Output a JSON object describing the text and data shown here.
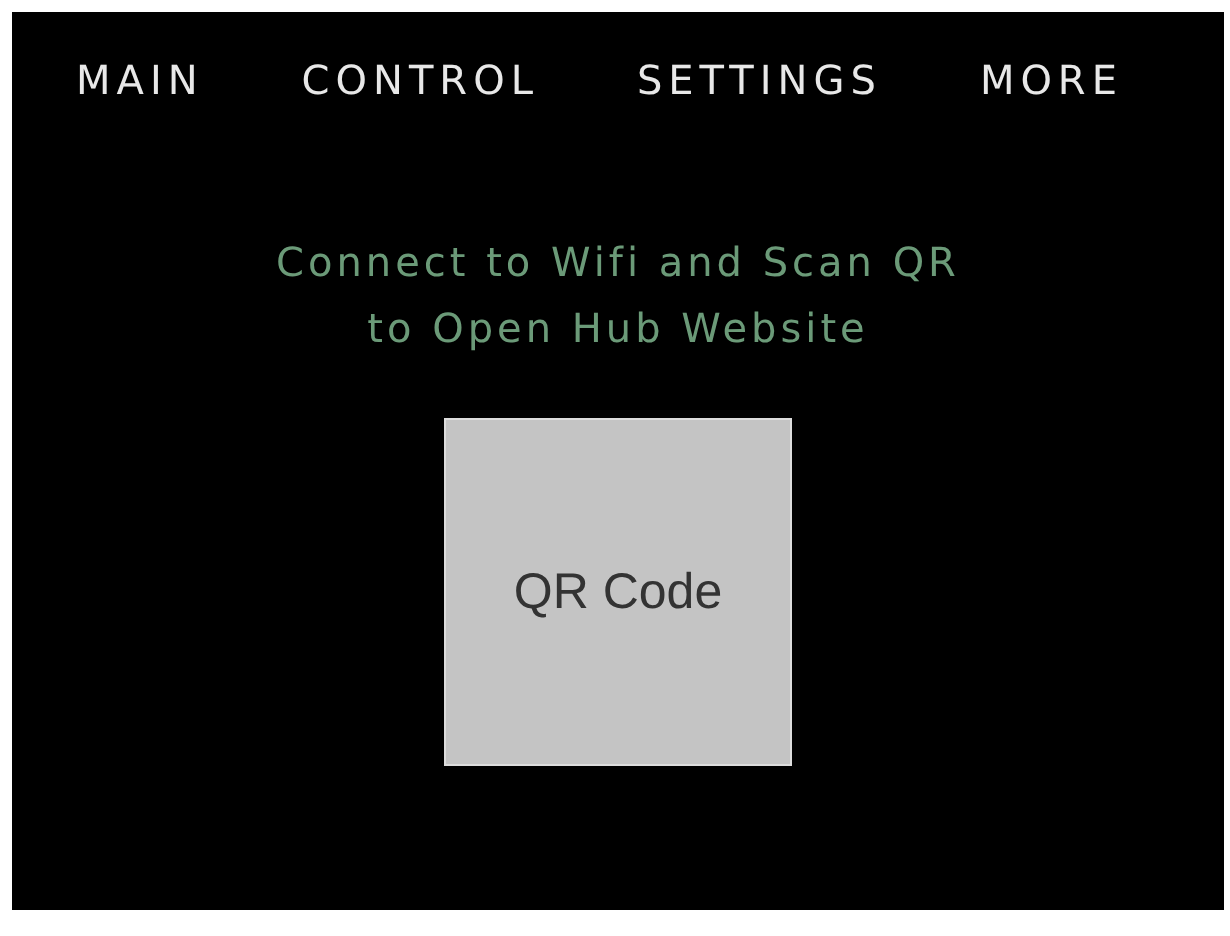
{
  "tabs": [
    {
      "label": "MAIN"
    },
    {
      "label": "CONTROL"
    },
    {
      "label": "SETTINGS"
    },
    {
      "label": "MORE"
    }
  ],
  "message": [
    "Connect to Wifi and Scan QR",
    "to Open Hub Website"
  ],
  "qr_placeholder": {
    "label": "QR Code"
  }
}
